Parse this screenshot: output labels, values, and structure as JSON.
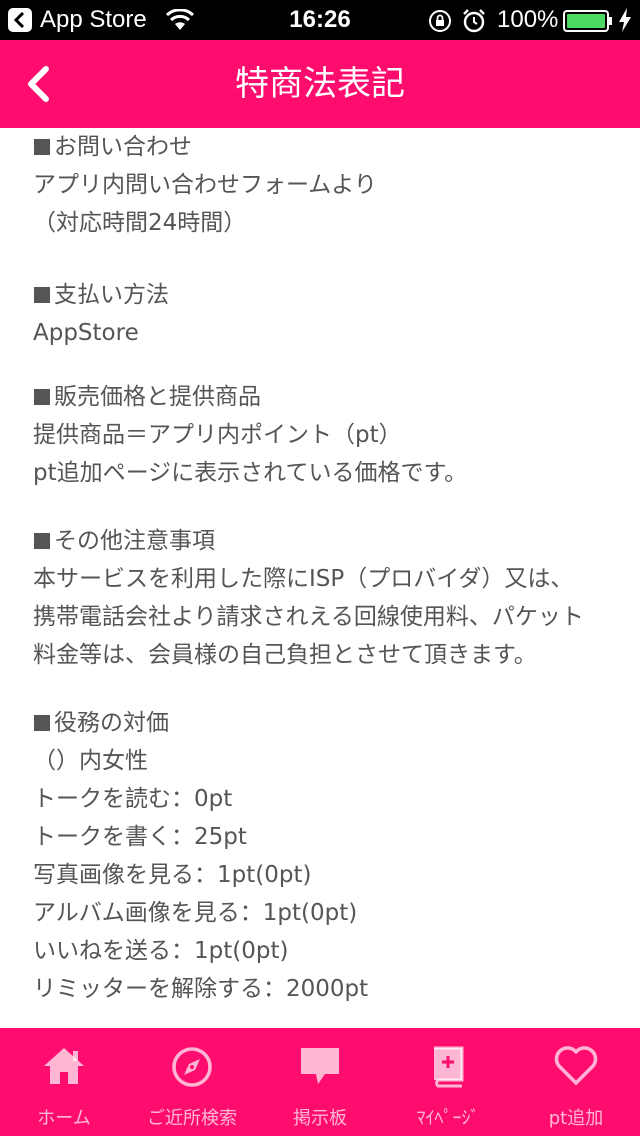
{
  "status_bar": {
    "back_label": "App Store",
    "time": "16:26",
    "battery": "100%"
  },
  "nav": {
    "title": "特商法表記"
  },
  "sections": [
    {
      "heading": "お問い合わせ",
      "lines": [
        "アプリ内問い合わせフォームより",
        "（対応時間24時間）"
      ]
    },
    {
      "heading": "支払い方法",
      "lines": [
        "AppStore"
      ]
    },
    {
      "heading": "販売価格と提供商品",
      "lines": [
        "提供商品＝アプリ内ポイント（pt）",
        "pt追加ページに表示されている価格です。"
      ]
    },
    {
      "heading": "その他注意事項",
      "lines": [
        "本サービスを利用した際にISP（プロバイダ）又は、",
        "携帯電話会社より請求されえる回線使用料、パケット",
        "料金等は、会員様の自己負担とさせて頂きます。"
      ]
    },
    {
      "heading": "役務の対価",
      "lines": [
        "（）内女性",
        "トークを読む：0pt",
        "トークを書く：25pt",
        "写真画像を見る：1pt(0pt)",
        "アルバム画像を見る：1pt(0pt)",
        "いいねを送る：1pt(0pt)",
        "リミッターを解除する：2000pt"
      ]
    }
  ],
  "tab_bar": {
    "tabs": [
      {
        "label": "ホーム",
        "icon": "home-icon"
      },
      {
        "label": "ご近所検索",
        "icon": "compass-icon"
      },
      {
        "label": "掲示板",
        "icon": "speech-bubble-icon"
      },
      {
        "label": "ﾏｲﾍﾟｰｼﾞ",
        "icon": "profile-book-icon"
      },
      {
        "label": "pt追加",
        "icon": "heart-icon"
      }
    ]
  },
  "colors": {
    "brand": "#ff0d6e",
    "text": "#555555",
    "battery": "#4cd964"
  }
}
